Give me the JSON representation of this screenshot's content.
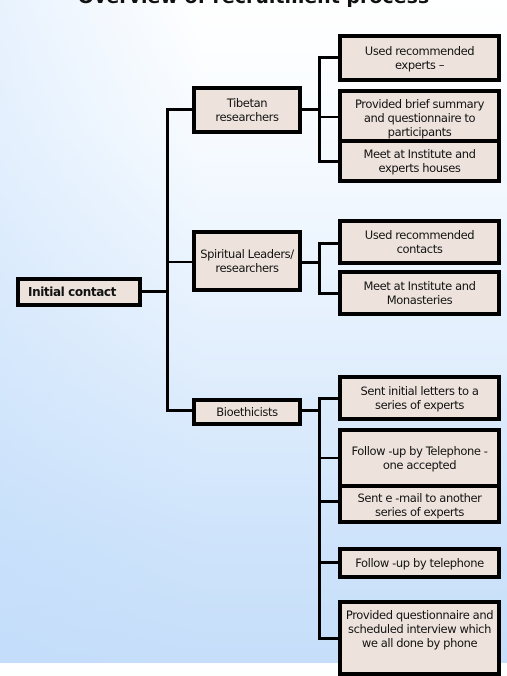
{
  "title": "Overview of recruitment process",
  "colors": {
    "box_fill": "#ede3dc",
    "box_border": "#000000",
    "connector": "#000000"
  },
  "root": {
    "label": "Initial contact"
  },
  "groups": [
    {
      "label": "Tibetan researchers",
      "steps": [
        "Used recommended experts  –",
        "Provided brief summary and questionnaire to participants",
        "Meet at Institute and experts houses"
      ]
    },
    {
      "label": "Spiritual Leaders/ researchers",
      "steps": [
        "Used recommended contacts",
        "Meet at Institute and Monasteries"
      ]
    },
    {
      "label": "Bioethicists",
      "steps": [
        "Sent initial letters to a series of experts",
        "Follow -up by Telephone - one accepted",
        "Sent e -mail to another series of experts",
        "Follow -up by telephone",
        "Provided questionnaire and scheduled interview which we all done by phone"
      ]
    }
  ]
}
